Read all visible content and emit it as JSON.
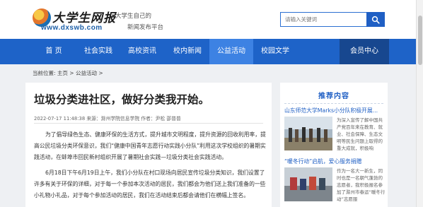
{
  "header": {
    "logo_title": "大学生网报",
    "logo_url": "www.dxswb.com",
    "slogan_line1": "大学生自己的",
    "slogan_line2": "新闻发布平台",
    "search_placeholder": "请输入关键词"
  },
  "nav": {
    "items": [
      "首 页",
      "社会实践",
      "高校资讯",
      "校内新闻",
      "公益活动",
      "校园文学"
    ],
    "active": "公益活动",
    "member": "会员中心"
  },
  "breadcrumb": "当前位置: 主页 > 公益活动 >",
  "article": {
    "title": "垃圾分类进社区，做好分类我开始。",
    "meta": "2022-07-17 11:48:38 来源：滁州学院信息学院  作者：尹松  邵普普",
    "paragraph1": "为了倡导绿色生态、健康环保的生活方式，提升城市文明程度，提升资源的回收利用率，提高公民垃圾分类环保意识，我们“健康中国青年志愿行动实践小分队”利用这次学校组织的暑期实践活动，在蚌埠市回民新村组织开展了暑期社会实践—垃圾分类社会实践活动。",
    "paragraph2": "6月18日下午6月19日上午，我们小分队在村口现场向居民宣传垃圾分类知识，我们设置了许多有关于环保的详细，对于每一个参加本次活动的居民，我们都会为他们送上我们准备的一些小礼物小礼品，对于每个参加活动的居民，我们在活动结束后都会请他们在横幅上签名。"
  },
  "sidebar": {
    "heading": "推荐内容",
    "items": [
      {
        "title": "山东师范大学Marks小分队积极开展...",
        "text": "为深入宣传了解中国共产党百年来在教育、就业、社会保障、生态文明等民生问题上取得的重大成就，积极响"
      },
      {
        "title": "“暖冬行动”启航，爱心服务捐赠",
        "text": "作为一名大一新生，同时也是一名朝气蓬勃的志愿者，我积极报名参加了滁州市春运“暖冬行动”志愿服"
      }
    ]
  },
  "colors": {
    "nav_bg": "#1e63c8",
    "nav_active": "#3d82e3",
    "member_bg": "#17478f",
    "accent": "#1f5fc4"
  }
}
